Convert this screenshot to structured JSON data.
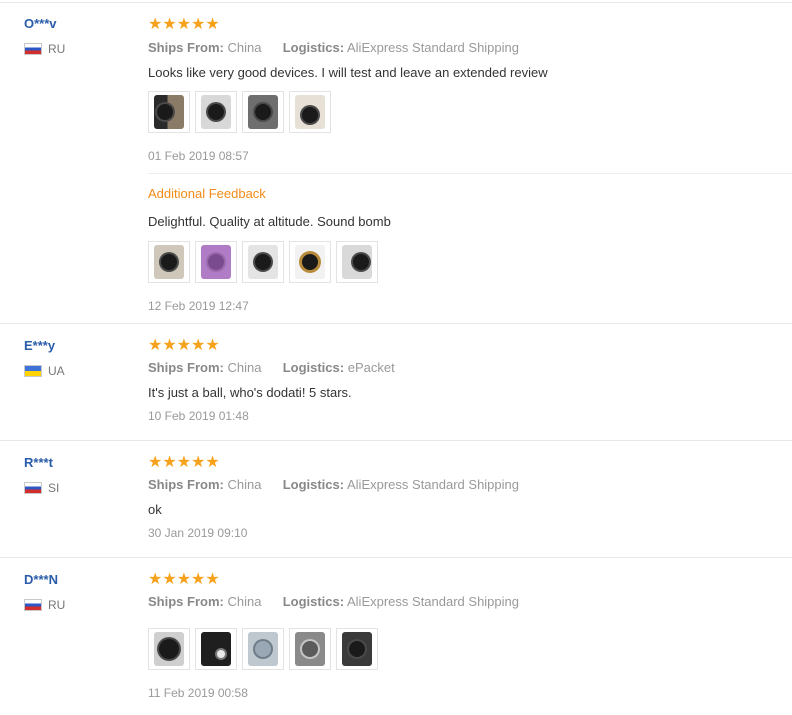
{
  "labels": {
    "ships_from": "Ships From:",
    "logistics": "Logistics:"
  },
  "colors": {
    "star": "#f7a21c",
    "username": "#2a5caa",
    "additional_feedback": "#f28b18"
  },
  "reviews": [
    {
      "user": "O***v",
      "country": "RU",
      "flag": "russia-flag",
      "stars": "★★★★★",
      "ships_from": "China",
      "logistics": "AliExpress Standard Shipping",
      "feedback": "Looks like very good devices. I will test and leave an extended review",
      "photos": 4,
      "date": "01 Feb 2019 08:57",
      "additional": {
        "title": "Additional Feedback",
        "feedback": "Delightful. Quality at altitude. Sound bomb",
        "photos": 5,
        "date": "12 Feb 2019 12:47"
      }
    },
    {
      "user": "E***y",
      "country": "UA",
      "flag": "ukraine-flag",
      "stars": "★★★★★",
      "ships_from": "China",
      "logistics": "ePacket",
      "feedback": "It's just a ball, who's dodati! 5 stars.",
      "date": "10 Feb 2019 01:48"
    },
    {
      "user": "R***t",
      "country": "SI",
      "flag": "slovenia-flag",
      "stars": "★★★★★",
      "ships_from": "China",
      "logistics": "AliExpress Standard Shipping",
      "feedback": "ok",
      "date": "30 Jan 2019 09:10"
    },
    {
      "user": "D***N",
      "country": "RU",
      "flag": "russia-flag",
      "stars": "★★★★★",
      "ships_from": "China",
      "logistics": "AliExpress Standard Shipping",
      "photos": 5,
      "date": "11 Feb 2019 00:58"
    }
  ]
}
